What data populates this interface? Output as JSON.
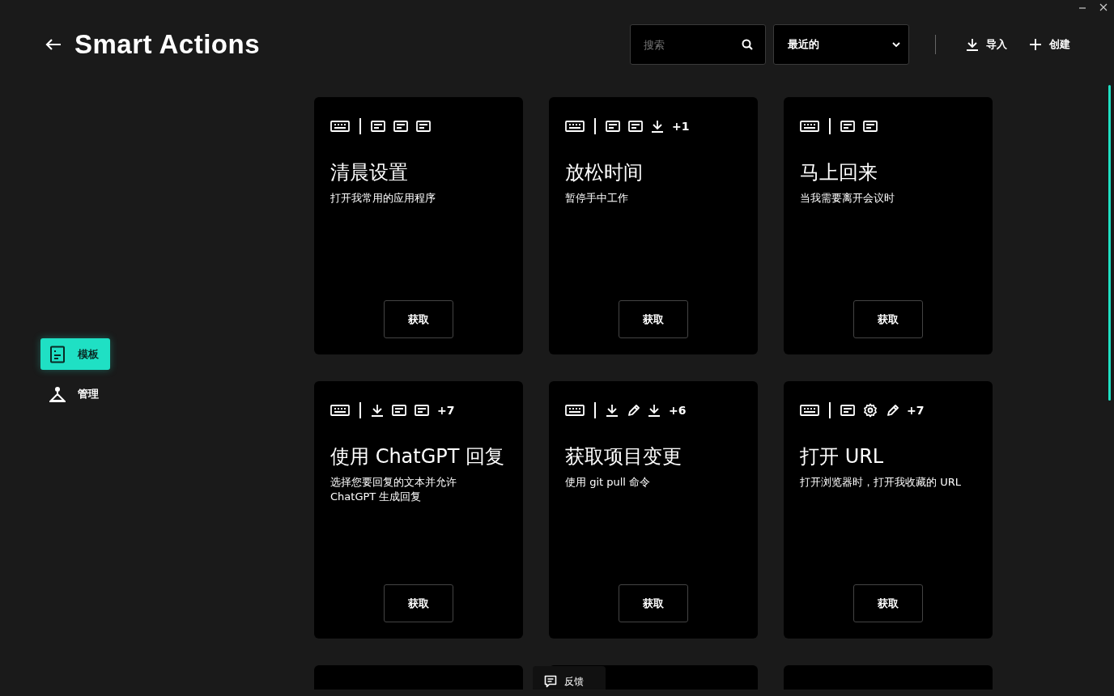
{
  "header": {
    "title": "Smart Actions",
    "search": {
      "placeholder": "搜索"
    },
    "sort": {
      "value": "最近的"
    },
    "actions": [
      {
        "kind": "import",
        "label": "导入"
      },
      {
        "kind": "create",
        "label": "创建"
      }
    ]
  },
  "sidebar": {
    "items": [
      {
        "kind": "templates",
        "label": "模板",
        "selected": true
      },
      {
        "kind": "manage",
        "label": "管理",
        "selected": false
      }
    ]
  },
  "cards": [
    {
      "icons": [
        {
          "kind": "keyboard"
        },
        {
          "kind": "text"
        },
        {
          "kind": "text"
        },
        {
          "kind": "text"
        }
      ],
      "title": "清晨设置",
      "description": "打开我常用的应用程序",
      "button": "获取"
    },
    {
      "icons": [
        {
          "kind": "keyboard"
        },
        {
          "kind": "text"
        },
        {
          "kind": "text"
        },
        {
          "kind": "download"
        }
      ],
      "more": "+1",
      "title": "放松时间",
      "description": "暂停手中工作",
      "button": "获取"
    },
    {
      "icons": [
        {
          "kind": "keyboard"
        },
        {
          "kind": "text"
        },
        {
          "kind": "text"
        }
      ],
      "title": "马上回来",
      "description": "当我需要离开会议时",
      "button": "获取"
    },
    {
      "icons": [
        {
          "kind": "keyboard"
        },
        {
          "kind": "download"
        },
        {
          "kind": "text"
        },
        {
          "kind": "text"
        }
      ],
      "more": "+7",
      "title": "使用 ChatGPT 回复",
      "description": "选择您要回复的文本并允许 ChatGPT 生成回复",
      "button": "获取"
    },
    {
      "icons": [
        {
          "kind": "keyboard"
        },
        {
          "kind": "download"
        },
        {
          "kind": "pencil"
        },
        {
          "kind": "download"
        }
      ],
      "more": "+6",
      "title": "获取项目变更",
      "description": "使用 git pull 命令",
      "button": "获取"
    },
    {
      "icons": [
        {
          "kind": "keyboard"
        },
        {
          "kind": "text"
        },
        {
          "kind": "gear"
        },
        {
          "kind": "pencil"
        }
      ],
      "more": "+7",
      "title": "打开 URL",
      "description": "打开浏览器时，打开我收藏的 URL",
      "button": "获取"
    },
    {
      "kind": "clipped"
    },
    {
      "kind": "clipped"
    },
    {
      "kind": "clipped"
    }
  ],
  "feedback": {
    "label": "反馈"
  }
}
